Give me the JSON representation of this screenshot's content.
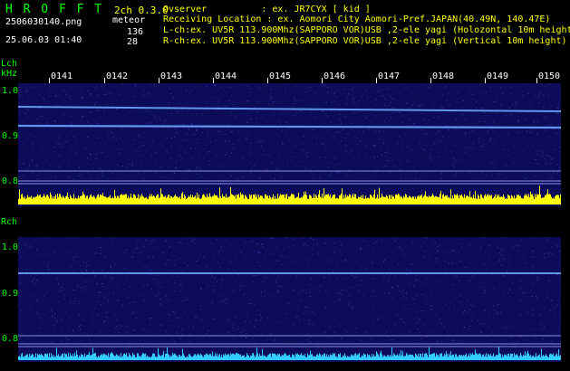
{
  "header": {
    "app_name": "H R O F F T",
    "mode": "2ch 0.3.0",
    "meteor_label": "meteor",
    "lch_count": "136",
    "rch_count": "28",
    "filename": "2506030140.png",
    "datetime": "25.06.03 01:40",
    "observer_line": "Ovserver          : ex. JR7CYX [ kid ]",
    "location_line": "Receiving Location : ex. Aomori City Aomori-Pref.JAPAN(40.49N, 140.47E)",
    "lch_line": "L-ch:ex. UV5R 113.900Mhz(SAPPORO VOR)USB ,2-ele yagi (Holozontal 10m height",
    "rch_line": "R-ch:ex. UV5R 113.900Mhz(SAPPORO VOR)USB ,2-ele yagi (Vertical 10m height)"
  },
  "lch": {
    "label": "Lch",
    "unit": "kHz",
    "time_ticks": [
      "0141",
      "0142",
      "0143",
      "0144",
      "0145",
      "0146",
      "0147",
      "0148",
      "0149",
      "0150"
    ],
    "freq_ticks": [
      "1.0",
      "0.9",
      "0.8"
    ]
  },
  "rch": {
    "label": "Rch",
    "freq_ticks": [
      "1.0",
      "0.9",
      "0.8"
    ]
  },
  "colors": {
    "spectrogram_bg": "#0c0c5a",
    "signal_line": "#6aa6ff",
    "marker_line": "#9aa0ff",
    "lch_activity": "#ffff00",
    "rch_activity": "#33ccff",
    "text_green": "#00ff00",
    "text_yellow": "#ffff00"
  }
}
